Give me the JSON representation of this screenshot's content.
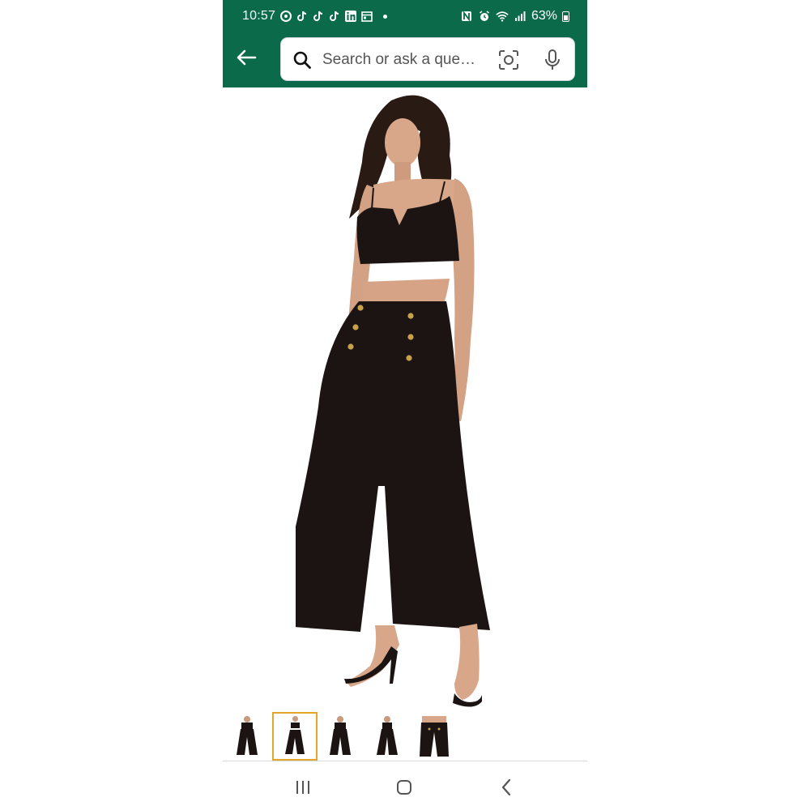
{
  "status_bar": {
    "time": "10:57",
    "battery": "63%",
    "left_icons": [
      "threads-icon",
      "tiktok-icon",
      "tiktok-icon",
      "tiktok-icon",
      "linkedin-icon",
      "calendar-icon"
    ],
    "right_icons": [
      "nfc-icon",
      "alarm-icon",
      "wifi-icon",
      "signal-icon",
      "battery-icon"
    ]
  },
  "header": {
    "back_icon": "arrow-left-icon",
    "search_placeholder": "Search or ask a que…",
    "camera_icon": "camera-scan-icon",
    "mic_icon": "microphone-icon"
  },
  "product_image": {
    "description_icon": "product-photo",
    "colors": {
      "garment": "#1b1413",
      "skin": "#d8a78a",
      "button": "#c8a24a"
    }
  },
  "thumbnails": {
    "selected_index": 1,
    "items": [
      "thumbnail-1",
      "thumbnail-2",
      "thumbnail-3",
      "thumbnail-4",
      "thumbnail-5"
    ]
  },
  "nav": {
    "recents_icon": "recents-icon",
    "home_icon": "home-icon",
    "back_icon": "nav-back-icon"
  },
  "colors": {
    "header_bg": "#0a6a4a",
    "selection": "#e3a52a"
  }
}
